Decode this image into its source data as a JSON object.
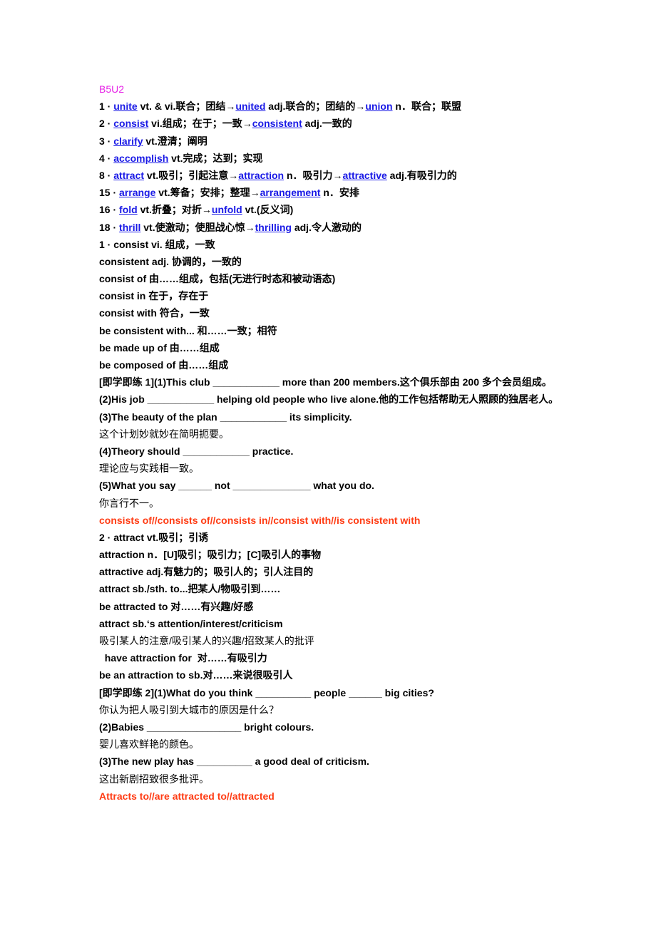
{
  "title": "B5U2",
  "vocab": [
    {
      "num": "1",
      "word": "unite",
      "def": " vt. & vi.联合；团结→",
      "w2": "united",
      "d2": " adj.联合的；团结的→",
      "w3": "union",
      "d3": " n．联合；联盟"
    },
    {
      "num": "2",
      "word": "consist",
      "def": " vi.组成；在于；一致→",
      "w2": "consistent",
      "d2": " adj.一致的",
      "w3": "",
      "d3": ""
    },
    {
      "num": "3",
      "word": "clarify",
      "def": " vt.澄清；阐明",
      "w2": "",
      "d2": "",
      "w3": "",
      "d3": ""
    },
    {
      "num": "4",
      "word": "accomplish",
      "def": " vt.完成；达到；实现",
      "w2": "",
      "d2": "",
      "w3": "",
      "d3": ""
    },
    {
      "num": "8",
      "word": "attract",
      "def": " vt.吸引；引起注意→",
      "w2": "attraction",
      "d2": " n．吸引力→",
      "w3": "attractive",
      "d3": " adj.有吸引力的"
    },
    {
      "num": "15",
      "word": "arrange",
      "def": " vt.筹备；安排；整理→",
      "w2": "arrangement",
      "d2": " n．安排",
      "w3": "",
      "d3": ""
    },
    {
      "num": "16",
      "word": "fold",
      "def": " vt.折叠；对折→",
      "w2": "unfold",
      "d2": " vt.(反义词)",
      "w3": "",
      "d3": ""
    },
    {
      "num": "18",
      "word": "thrill",
      "def": " vt.使激动；使胆战心惊→",
      "w2": "thrilling",
      "d2": " adj.令人激动的",
      "w3": "",
      "d3": ""
    }
  ],
  "section1": {
    "lines": [
      "1 · consist vi.  组成，一致",
      "consistent adj.  协调的，一致的",
      "consist of  由……组成，包括(无进行时态和被动语态)",
      "consist in  在于，存在于",
      "consist with  符合，一致",
      "be consistent with...  和……一致；相符",
      "be made up of  由……组成",
      "be composed of  由……组成"
    ],
    "exercise": [
      " [即学即练 1](1)This club ____________ more than 200 members.这个俱乐部由 200 多个会员组成。",
      "(2)His job ____________ helping old people who live alone.他的工作包括帮助无人照顾的独居老人。",
      "(3)The beauty of the plan ____________ its simplicity.",
      "这个计划妙就妙在简明扼要。",
      "(4)Theory should ____________ practice.",
      "理论应与实践相一致。",
      "(5)What you say ______ not ______________ what you do.",
      "你言行不一。"
    ],
    "answer": "consists of//consists of//consists in//consist with//is consistent with"
  },
  "section2": {
    "lines": [
      "2 · attract vt.吸引；引诱",
      "attraction n．[U]吸引；吸引力；[C]吸引人的事物",
      "attractive adj.有魅力的；吸引人的；引人注目的",
      "attract sb./sth. to...把某人/物吸引到……",
      "be attracted to  对……有兴趣/好感",
      "attract sb.‘s attention/interest/criticism",
      "吸引某人的注意/吸引某人的兴趣/招致某人的批评",
      "  have attraction for  对……有吸引力",
      "be an attraction to sb.对……来说很吸引人"
    ],
    "exercise": [
      " [即学即练 2](1)What do you think __________ people ______ big cities?",
      "你认为把人吸引到大城市的原因是什么？",
      "(2)Babies _________________ bright colours.",
      "婴儿喜欢鲜艳的颜色。",
      "(3)The new play has __________ a good deal of criticism.",
      "这出新剧招致很多批评。"
    ],
    "answer": "Attracts to//are attracted to//attracted"
  }
}
